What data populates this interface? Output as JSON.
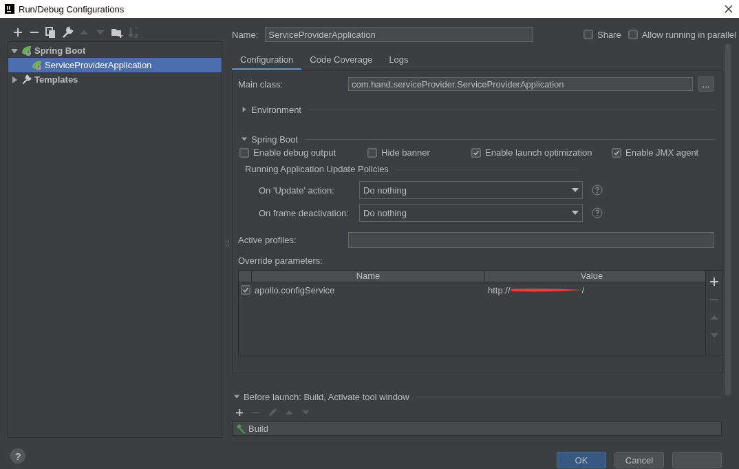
{
  "window": {
    "title": "Run/Debug Configurations"
  },
  "sidebar": {
    "toolbar": [
      {
        "kind": "add",
        "disabled": false
      },
      {
        "kind": "remove",
        "disabled": false
      },
      {
        "kind": "copy",
        "disabled": false
      },
      {
        "kind": "wrench",
        "disabled": false
      },
      {
        "kind": "up",
        "disabled": true
      },
      {
        "kind": "down",
        "disabled": true
      },
      {
        "kind": "folder",
        "disabled": false
      },
      {
        "kind": "sort",
        "disabled": true
      }
    ],
    "tree": [
      {
        "label": "Spring Boot",
        "kind": "spring",
        "expanded": true,
        "selected": false,
        "children": [
          {
            "label": "ServiceProviderApplication",
            "kind": "spring",
            "selected": true
          }
        ]
      },
      {
        "label": "Templates",
        "kind": "wrench",
        "expanded": false,
        "selected": false
      }
    ]
  },
  "name_field": {
    "label": "Name:",
    "value": "ServiceProviderApplication"
  },
  "options": [
    {
      "label": "Share",
      "checked": false
    },
    {
      "label": "Allow running in parallel",
      "checked": false
    }
  ],
  "tabs": [
    {
      "label": "Configuration",
      "selected": true
    },
    {
      "label": "Code Coverage",
      "selected": false
    },
    {
      "label": "Logs",
      "selected": false
    }
  ],
  "main_class": {
    "label": "Main class:",
    "value": "com.hand.serviceProvider.ServiceProviderApplication",
    "browse": "..."
  },
  "sections": [
    {
      "title": "Environment",
      "expanded": false
    },
    {
      "title": "Spring Boot",
      "expanded": true
    }
  ],
  "spring_boot_options": [
    {
      "label": "Enable debug output",
      "checked": false
    },
    {
      "label": "Hide banner",
      "checked": false
    },
    {
      "label": "Enable launch optimization",
      "checked": true
    },
    {
      "label": "Enable JMX agent",
      "checked": true
    }
  ],
  "update_policies": {
    "title": "Running Application Update Policies",
    "fields": [
      {
        "label": "On 'Update' action:",
        "value": "Do nothing"
      },
      {
        "label": "On frame deactivation:",
        "value": "Do nothing"
      }
    ]
  },
  "active_profiles": {
    "label": "Active profiles:"
  },
  "override_parameters": {
    "label": "Override parameters:",
    "columns": [
      "Name",
      "Value"
    ],
    "rows": [
      {
        "checked": true,
        "name": "apollo.configService",
        "value_start": "http://",
        "value_end": "/",
        "redacted": true
      }
    ],
    "toolbar": [
      {
        "kind": "add",
        "disabled": false
      },
      {
        "kind": "remove",
        "disabled": true
      },
      {
        "kind": "up",
        "disabled": true
      },
      {
        "kind": "down",
        "disabled": true
      }
    ]
  },
  "before_launch": {
    "title": "Before launch: Build, Activate tool window",
    "expanded": true,
    "toolbar": [
      {
        "kind": "add",
        "disabled": false
      },
      {
        "kind": "remove",
        "disabled": true
      },
      {
        "kind": "edit",
        "disabled": true
      },
      {
        "kind": "up",
        "disabled": true
      },
      {
        "kind": "down",
        "disabled": true
      }
    ],
    "tasks": [
      {
        "label": "Build",
        "selected": false
      }
    ]
  },
  "help_button": "?",
  "buttons": [
    {
      "label": "OK",
      "kind": "primary"
    },
    {
      "label": "Cancel",
      "kind": "normal"
    },
    {
      "kind": "normal"
    }
  ]
}
